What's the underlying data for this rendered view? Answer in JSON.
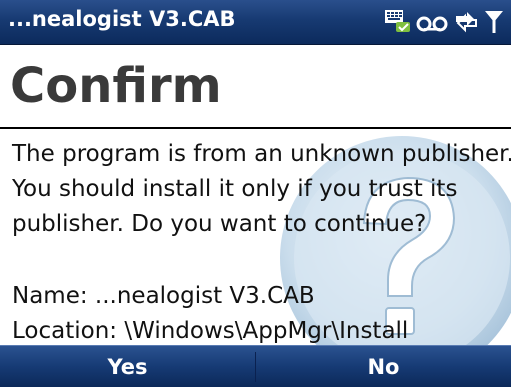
{
  "titlebar": {
    "title": "...nealogist V3.CAB",
    "icons": [
      "input-panel-icon",
      "voicemail-icon",
      "connectivity-icon",
      "signal-icon"
    ]
  },
  "dialog": {
    "heading": "Confirm",
    "message_lines": [
      "The program is from an unknown publisher.",
      "You should install it only if you trust its",
      "publisher. Do you want to continue?"
    ],
    "name_line": "Name: ...nealogist V3.CAB",
    "location_line": "Location: \\Windows\\AppMgr\\Install"
  },
  "softkeys": {
    "left": "Yes",
    "right": "No"
  },
  "colors": {
    "bar": "#173a72",
    "heading": "#3a3a3a",
    "watermark": "#aac8e0"
  }
}
